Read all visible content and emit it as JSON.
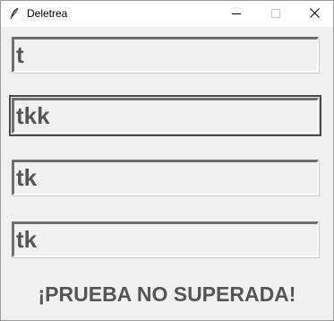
{
  "window": {
    "title": "Deletrea",
    "app_icon": "feather-icon",
    "controls": [
      "minimize-icon",
      "maximize-icon",
      "close-icon"
    ]
  },
  "entries": [
    {
      "value": "t",
      "focused": false
    },
    {
      "value": "tkk",
      "focused": true
    },
    {
      "value": "tk",
      "focused": false
    },
    {
      "value": "tk",
      "focused": false
    }
  ],
  "result": {
    "message": "¡PRUEBA NO SUPERADA!"
  },
  "colors": {
    "background": "#f0f0f0",
    "text": "#555555"
  }
}
